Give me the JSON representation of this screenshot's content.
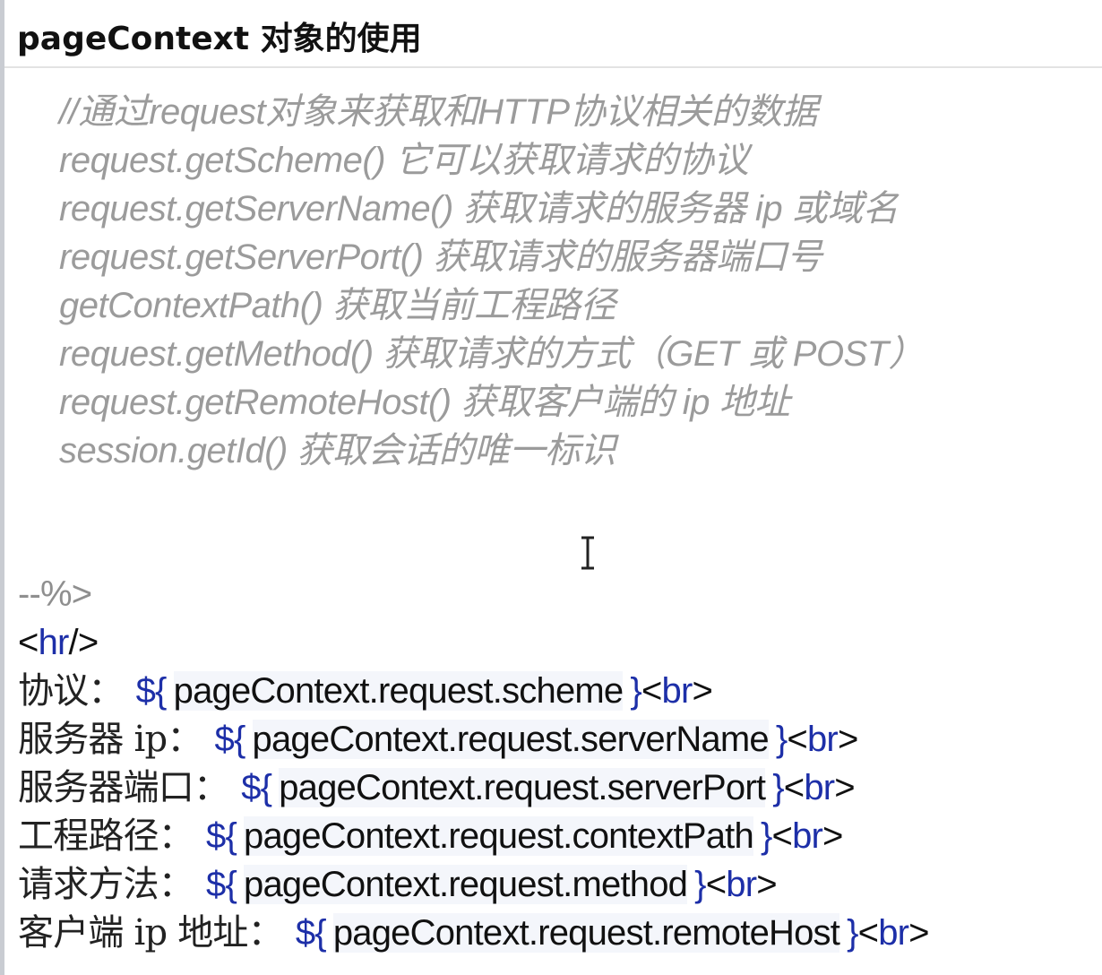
{
  "heading": "pageContext 对象的使用",
  "comment_lines": [
    "//通过request对象来获取和HTTP协议相关的数据",
    "request.getScheme() 它可以获取请求的协议",
    "request.getServerName() 获取请求的服务器 ip 或域名",
    "request.getServerPort() 获取请求的服务器端口号",
    "getContextPath() 获取当前工程路径",
    "request.getMethod() 获取请求的方式（GET 或 POST）",
    "request.getRemoteHost() 获取客户端的 ip 地址",
    "session.getId() 获取会话的唯一标识"
  ],
  "comment_close": "--%>",
  "hr_tag": {
    "open": "<",
    "name": "hr",
    "close": "/>"
  },
  "el_rows": [
    {
      "label": "协议：",
      "open": "${",
      "expr": "pageContext.request.scheme",
      "close": "}",
      "br_open": "<",
      "br_name": "br",
      "br_close": ">"
    },
    {
      "label": "服务器 ip：",
      "open": "${",
      "expr": "pageContext.request.serverName",
      "close": "}",
      "br_open": "<",
      "br_name": "br",
      "br_close": ">"
    },
    {
      "label": "服务器端口：",
      "open": "${",
      "expr": "pageContext.request.serverPort",
      "close": "}",
      "br_open": "<",
      "br_name": "br",
      "br_close": ">"
    },
    {
      "label": "工程路径：",
      "open": "${",
      "expr": "pageContext.request.contextPath",
      "close": "}",
      "br_open": "<",
      "br_name": "br",
      "br_close": ">"
    },
    {
      "label": "请求方法：",
      "open": "${",
      "expr": "pageContext.request.method",
      "close": "}",
      "br_open": "<",
      "br_name": "br",
      "br_close": ">"
    },
    {
      "label": "客户端 ip 地址：",
      "open": "${",
      "expr": "pageContext.request.remoteHost",
      "close": "}",
      "br_open": "<",
      "br_name": "br",
      "br_close": ">"
    }
  ],
  "icons": {
    "cursor": "text-cursor-icon"
  },
  "colors": {
    "comment": "#9b9b9b",
    "el_brace": "#1d2fa8",
    "tag_name": "#1d2fa8",
    "text": "#111111"
  }
}
